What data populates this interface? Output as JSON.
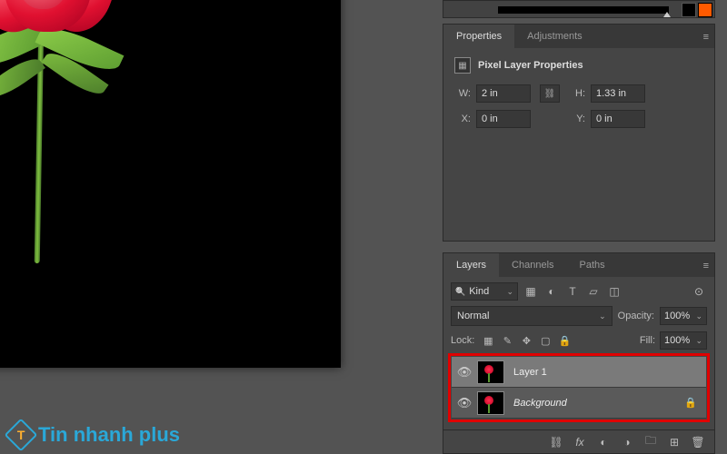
{
  "panels": {
    "properties": {
      "tab_properties": "Properties",
      "tab_adjustments": "Adjustments",
      "title": "Pixel Layer Properties",
      "w_label": "W:",
      "w_value": "2 in",
      "h_label": "H:",
      "h_value": "1.33 in",
      "x_label": "X:",
      "x_value": "0 in",
      "y_label": "Y:",
      "y_value": "0 in"
    },
    "layers": {
      "tab_layers": "Layers",
      "tab_channels": "Channels",
      "tab_paths": "Paths",
      "kind_label": "Kind",
      "blend_mode": "Normal",
      "opacity_label": "Opacity:",
      "opacity_value": "100%",
      "lock_label": "Lock:",
      "fill_label": "Fill:",
      "fill_value": "100%",
      "items": [
        {
          "name": "Layer 1",
          "locked": false,
          "selected": true
        },
        {
          "name": "Background",
          "locked": true,
          "selected": false
        }
      ]
    }
  },
  "watermark": {
    "logo_letter": "T",
    "text": "Tin nhanh plus"
  }
}
